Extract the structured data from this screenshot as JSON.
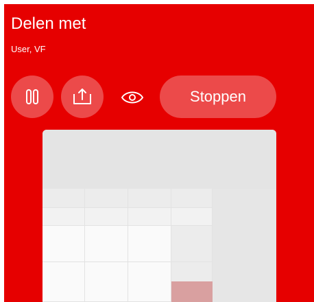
{
  "header": {
    "title": "Delen met",
    "participants": "User, VF"
  },
  "controls": {
    "pause_icon": "pause-icon",
    "share_icon": "share-icon",
    "preview_toggle_icon": "eye-icon",
    "stop_label": "Stoppen"
  },
  "colors": {
    "background_red": "#e60000",
    "button_red": "#ec4a4a",
    "text_white": "#ffffff"
  }
}
